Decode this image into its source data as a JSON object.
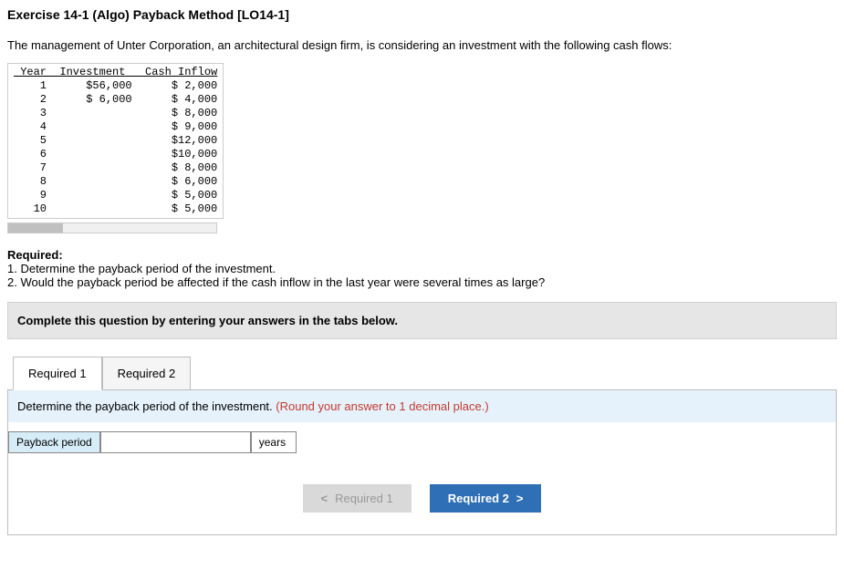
{
  "title": "Exercise 14-1 (Algo) Payback Method [LO14-1]",
  "intro": "The management of Unter Corporation, an architectural design firm, is considering an investment with the following cash flows:",
  "table": {
    "headers": [
      "Year",
      "Investment",
      "Cash Inflow"
    ],
    "rows": [
      {
        "year": "1",
        "investment": "$56,000",
        "inflow": "$ 2,000"
      },
      {
        "year": "2",
        "investment": "$ 6,000",
        "inflow": "$ 4,000"
      },
      {
        "year": "3",
        "investment": "",
        "inflow": "$ 8,000"
      },
      {
        "year": "4",
        "investment": "",
        "inflow": "$ 9,000"
      },
      {
        "year": "5",
        "investment": "",
        "inflow": "$12,000"
      },
      {
        "year": "6",
        "investment": "",
        "inflow": "$10,000"
      },
      {
        "year": "7",
        "investment": "",
        "inflow": "$ 8,000"
      },
      {
        "year": "8",
        "investment": "",
        "inflow": "$ 6,000"
      },
      {
        "year": "9",
        "investment": "",
        "inflow": "$ 5,000"
      },
      {
        "year": "10",
        "investment": "",
        "inflow": "$ 5,000"
      }
    ]
  },
  "required": {
    "header": "Required:",
    "q1": "1. Determine the payback period of the investment.",
    "q2": "2. Would the payback period be affected if the cash inflow in the last year were several times as large?"
  },
  "instruction_bar": "Complete this question by entering your answers in the tabs below.",
  "tabs": {
    "t1": "Required 1",
    "t2": "Required 2"
  },
  "panel": {
    "prompt_black": "Determine the payback period of the investment. ",
    "prompt_red": "(Round your answer to 1 decimal place.)",
    "row_label": "Payback period",
    "unit": "years"
  },
  "nav": {
    "prev": "Required 1",
    "next": "Required 2"
  },
  "chart_data": {
    "type": "table",
    "columns": [
      "Year",
      "Investment",
      "Cash Inflow"
    ],
    "rows": [
      [
        1,
        56000,
        2000
      ],
      [
        2,
        6000,
        4000
      ],
      [
        3,
        null,
        8000
      ],
      [
        4,
        null,
        9000
      ],
      [
        5,
        null,
        12000
      ],
      [
        6,
        null,
        10000
      ],
      [
        7,
        null,
        8000
      ],
      [
        8,
        null,
        6000
      ],
      [
        9,
        null,
        5000
      ],
      [
        10,
        null,
        5000
      ]
    ]
  }
}
